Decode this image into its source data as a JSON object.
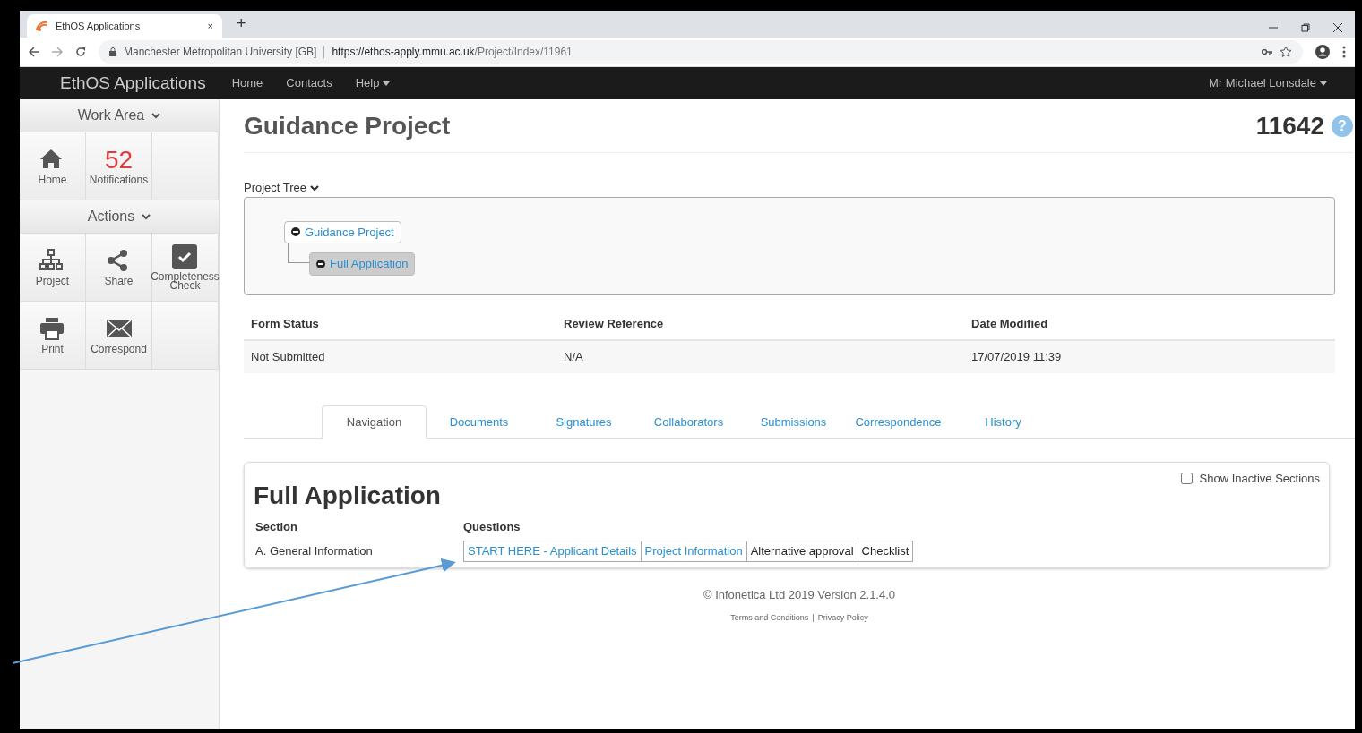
{
  "browser": {
    "tab_title": "EthOS Applications",
    "tab_close": "×",
    "new_tab": "+",
    "site": "Manchester Metropolitan University [GB]",
    "url_host": "https://ethos-apply.mmu.ac.uk",
    "url_path": "/Project/Index/11961"
  },
  "navbar": {
    "brand": "EthOS Applications",
    "links": [
      {
        "label": "Home",
        "dropdown": false
      },
      {
        "label": "Contacts",
        "dropdown": false
      },
      {
        "label": "Help",
        "dropdown": true
      }
    ],
    "user": {
      "label": "Mr Michael Lonsdale",
      "dropdown": true
    }
  },
  "sidebar": {
    "sections": [
      {
        "title": "Work Area",
        "rows": [
          [
            {
              "kind": "icon",
              "label": "Home"
            },
            {
              "kind": "counter",
              "count": "52",
              "label": "Notifications"
            }
          ]
        ]
      },
      {
        "title": "Actions",
        "rows": [
          [
            {
              "kind": "icon",
              "label": "Project"
            },
            {
              "kind": "icon",
              "label": "Share"
            },
            {
              "kind": "icon",
              "label": "Completeness Check"
            }
          ],
          [
            {
              "kind": "icon",
              "label": "Print"
            },
            {
              "kind": "icon",
              "label": "Correspond"
            }
          ]
        ]
      }
    ]
  },
  "page": {
    "title": "Guidance Project",
    "number": "11642",
    "help": "?"
  },
  "project_tree": {
    "label": "Project Tree",
    "nodes": [
      {
        "label": "Guidance Project",
        "expanded": true,
        "selected": false,
        "children": [
          {
            "label": "Full Application",
            "expanded": true,
            "selected": true
          }
        ]
      }
    ]
  },
  "status_table": {
    "columns": [
      "Form Status",
      "Review Reference",
      "Date Modified"
    ],
    "rows": [
      [
        "Not Submitted",
        "N/A",
        "17/07/2019 11:39"
      ]
    ]
  },
  "tabs": [
    {
      "label": "Navigation",
      "selected": true
    },
    {
      "label": "Documents",
      "selected": false
    },
    {
      "label": "Signatures",
      "selected": false
    },
    {
      "label": "Collaborators",
      "selected": false
    },
    {
      "label": "Submissions",
      "selected": false
    },
    {
      "label": "Correspondence",
      "selected": false
    },
    {
      "label": "History",
      "selected": false
    }
  ],
  "panel": {
    "title": "Full Application",
    "show_inactive": {
      "label": "Show Inactive Sections",
      "checked": false
    },
    "columns": [
      "Section",
      "Questions"
    ],
    "rows": [
      {
        "section": "A. General Information",
        "questions": [
          {
            "label": "START HERE - Applicant Details",
            "linked": true
          },
          {
            "label": "Project Information",
            "linked": true
          },
          {
            "label": "Alternative approval",
            "linked": false
          },
          {
            "label": "Checklist",
            "linked": false
          }
        ]
      }
    ]
  },
  "footer": {
    "copyright": "© Infonetica Ltd 2019 Version 2.1.4.0",
    "links": [
      "Terms and Conditions",
      "Privacy Policy"
    ],
    "separator": "|"
  }
}
